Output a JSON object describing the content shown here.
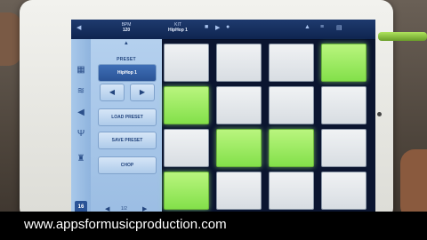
{
  "topbar": {
    "items": [
      {
        "label": "BPM",
        "value": "120"
      },
      {
        "label": "KIT",
        "value": "HipHop 1"
      }
    ]
  },
  "sidebar": {
    "icons": [
      "keyboard-icon",
      "waveform-icon",
      "speaker-icon",
      "fork-icon",
      "stamp-icon"
    ],
    "bottom_badge": "16"
  },
  "preset_panel": {
    "up_arrow": "▲",
    "preset_label": "PRESET",
    "preset_value": "HipHop 1",
    "prev_arrow": "◀",
    "next_arrow": "▶",
    "load_label": "LOAD PRESET",
    "save_label": "SAVE PRESET",
    "chop_label": "CHOP",
    "page_indicator": "1/2"
  },
  "pads": [
    {
      "label": "",
      "on": false
    },
    {
      "label": "",
      "on": false
    },
    {
      "label": "",
      "on": false
    },
    {
      "label": "",
      "on": true
    },
    {
      "label": "",
      "on": true
    },
    {
      "label": "",
      "on": false
    },
    {
      "label": "",
      "on": false
    },
    {
      "label": "",
      "on": false
    },
    {
      "label": "",
      "on": false
    },
    {
      "label": "",
      "on": true
    },
    {
      "label": "",
      "on": true
    },
    {
      "label": "",
      "on": false
    },
    {
      "label": "",
      "on": true
    },
    {
      "label": "",
      "on": false
    },
    {
      "label": "",
      "on": false
    },
    {
      "label": "",
      "on": false
    }
  ],
  "caption": "www.appsformusicproduction.com",
  "colors": {
    "pad_on": "#9cec63",
    "pad_off": "#e6e9ec",
    "panel": "#a8c8ea",
    "topbar": "#163a72"
  }
}
